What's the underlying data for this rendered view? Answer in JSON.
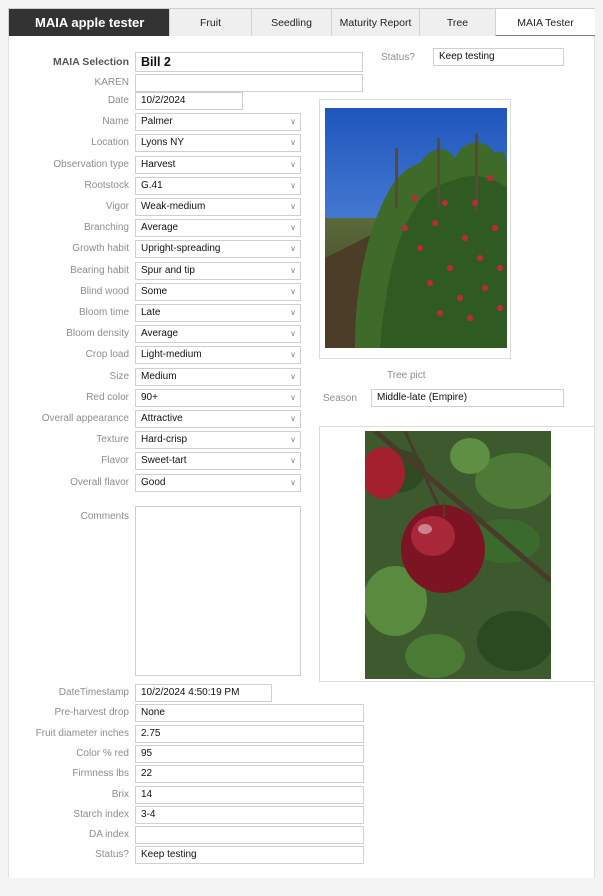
{
  "app": {
    "title": "MAIA apple tester"
  },
  "tabs": [
    {
      "label": "Fruit",
      "active": false
    },
    {
      "label": "Seedling",
      "active": false
    },
    {
      "label": "Maturity Report",
      "active": false
    },
    {
      "label": "Tree",
      "active": false
    },
    {
      "label": "MAIA Tester",
      "active": true
    }
  ],
  "header": {
    "selection_label": "MAIA Selection",
    "selection_value": "Bill 2",
    "karen_label": "KAREN",
    "karen_value": "",
    "status_label": "Status?",
    "status_value": "Keep testing"
  },
  "fields": [
    {
      "label": "Date",
      "value": "10/2/2024",
      "dropdown": false
    },
    {
      "label": "Name",
      "value": "Palmer",
      "dropdown": true
    },
    {
      "label": "Location",
      "value": "Lyons NY",
      "dropdown": true
    },
    {
      "label": "Observation type",
      "value": "Harvest",
      "dropdown": true
    },
    {
      "label": "Rootstock",
      "value": "G.41",
      "dropdown": true
    },
    {
      "label": "Vigor",
      "value": "Weak-medium",
      "dropdown": true
    },
    {
      "label": "Branching",
      "value": "Average",
      "dropdown": true
    },
    {
      "label": "Growth habit",
      "value": "Upright-spreading",
      "dropdown": true
    },
    {
      "label": "Bearing habit",
      "value": "Spur and tip",
      "dropdown": true
    },
    {
      "label": "Blind wood",
      "value": "Some",
      "dropdown": true
    },
    {
      "label": "Bloom time",
      "value": "Late",
      "dropdown": true
    },
    {
      "label": "Bloom density",
      "value": "Average",
      "dropdown": true
    },
    {
      "label": "Crop load",
      "value": "Light-medium",
      "dropdown": true
    },
    {
      "label": "Size",
      "value": "Medium",
      "dropdown": true
    },
    {
      "label": "Red color",
      "value": "90+",
      "dropdown": true
    },
    {
      "label": "Overall appearance",
      "value": "Attractive",
      "dropdown": true
    },
    {
      "label": "Texture",
      "value": "Hard-crisp",
      "dropdown": true
    },
    {
      "label": "Flavor",
      "value": "Sweet-tart",
      "dropdown": true
    },
    {
      "label": "Overall flavor",
      "value": "Good",
      "dropdown": true
    }
  ],
  "comments": {
    "label": "Comments",
    "value": ""
  },
  "tree_pict": {
    "label": "Tree pict"
  },
  "season": {
    "label": "Season",
    "value": "Middle-late (Empire)"
  },
  "lower_fields": [
    {
      "label": "DateTimestamp",
      "value": "10/2/2024 4:50:19 PM"
    },
    {
      "label": "Pre-harvest drop",
      "value": "None"
    },
    {
      "label": "Fruit diameter inches",
      "value": "2.75"
    },
    {
      "label": "Color % red",
      "value": "95"
    },
    {
      "label": "Firmness lbs",
      "value": "22"
    },
    {
      "label": "Brix",
      "value": "14"
    },
    {
      "label": "Starch index",
      "value": "3-4"
    },
    {
      "label": "DA index",
      "value": ""
    },
    {
      "label": "Status?",
      "value": "Keep testing"
    }
  ],
  "icons": {
    "dropdown": "chevron-down-icon"
  },
  "colors": {
    "title_bar": "#333333",
    "label": "#8d8d8d",
    "sky": "#2a63c4",
    "apple_red": "#9b1b30"
  }
}
